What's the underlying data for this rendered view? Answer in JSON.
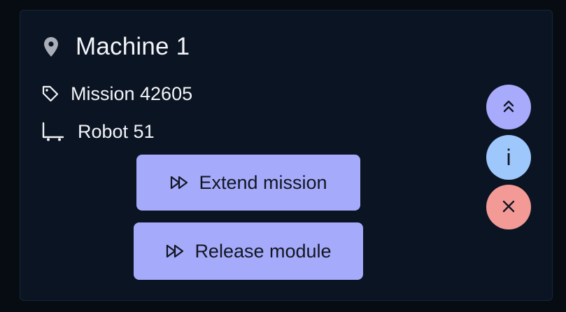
{
  "card": {
    "title": "Machine 1",
    "title_icon": "location-pin-icon",
    "mission_label": "Mission 42605",
    "mission_icon": "tag-icon",
    "robot_label": "Robot 51",
    "robot_icon": "robot-cart-icon"
  },
  "actions": {
    "extend_label": "Extend mission",
    "release_label": "Release module",
    "action_icon": "fast-forward-icon"
  },
  "fabs": {
    "info_glyph": "i",
    "collapse_icon": "chevron-double-up-icon",
    "info_icon": "info-icon",
    "close_icon": "close-icon"
  },
  "colors": {
    "background": "#070b12",
    "card_background": "#0b1422",
    "button_primary": "#a6aafa",
    "fab_collapse": "#a8aafb",
    "fab_info": "#9ec7fb",
    "fab_close": "#f49a96",
    "text_primary": "#f2f4f8"
  }
}
